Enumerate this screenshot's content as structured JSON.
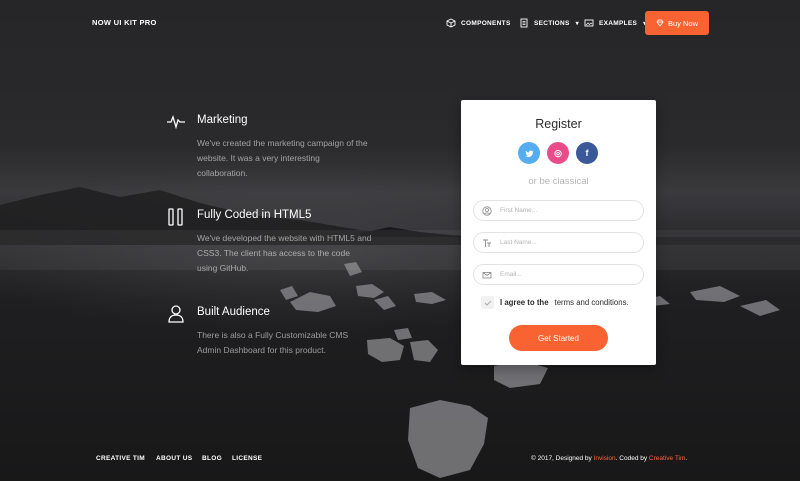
{
  "brand": "NOW UI KIT PRO",
  "nav": {
    "components": "COMPONENTS",
    "sections": "SECTIONS",
    "examples": "EXAMPLES",
    "buy": "Buy Now",
    "caret": "▾"
  },
  "features": [
    {
      "title": "Marketing",
      "text": "We've created the marketing campaign of the website. It was a very interesting collaboration.",
      "icon": "pulse-icon"
    },
    {
      "title": "Fully Coded in HTML5",
      "text": "We've developed the website with HTML5 and CSS3. The client has access to the code using GitHub.",
      "icon": "columns-icon"
    },
    {
      "title": "Built Audience",
      "text": "There is also a Fully Customizable CMS Admin Dashboard for this product.",
      "icon": "user-icon"
    }
  ],
  "register": {
    "title": "Register",
    "social": {
      "twitter": "t",
      "dribbble": "◎",
      "facebook": "f"
    },
    "or_text": "or be classical",
    "first_name_placeholder": "First Name...",
    "last_name_placeholder": "Last Name...",
    "email_placeholder": "Email...",
    "agree_prefix": "I agree to the",
    "agree_link": "terms and conditions.",
    "submit": "Get Started"
  },
  "footer": {
    "links": [
      "CREATIVE TIM",
      "ABOUT US",
      "BLOG",
      "LICENSE"
    ],
    "copyright_prefix": "© 2017, Designed by",
    "designer": "Invision",
    "coded_by": ". Coded by",
    "coder": "Creative Tim",
    "suffix": "."
  },
  "colors": {
    "accent": "#f96332",
    "twitter": "#55acee",
    "dribbble": "#ea4c89",
    "facebook": "#3b5998"
  }
}
